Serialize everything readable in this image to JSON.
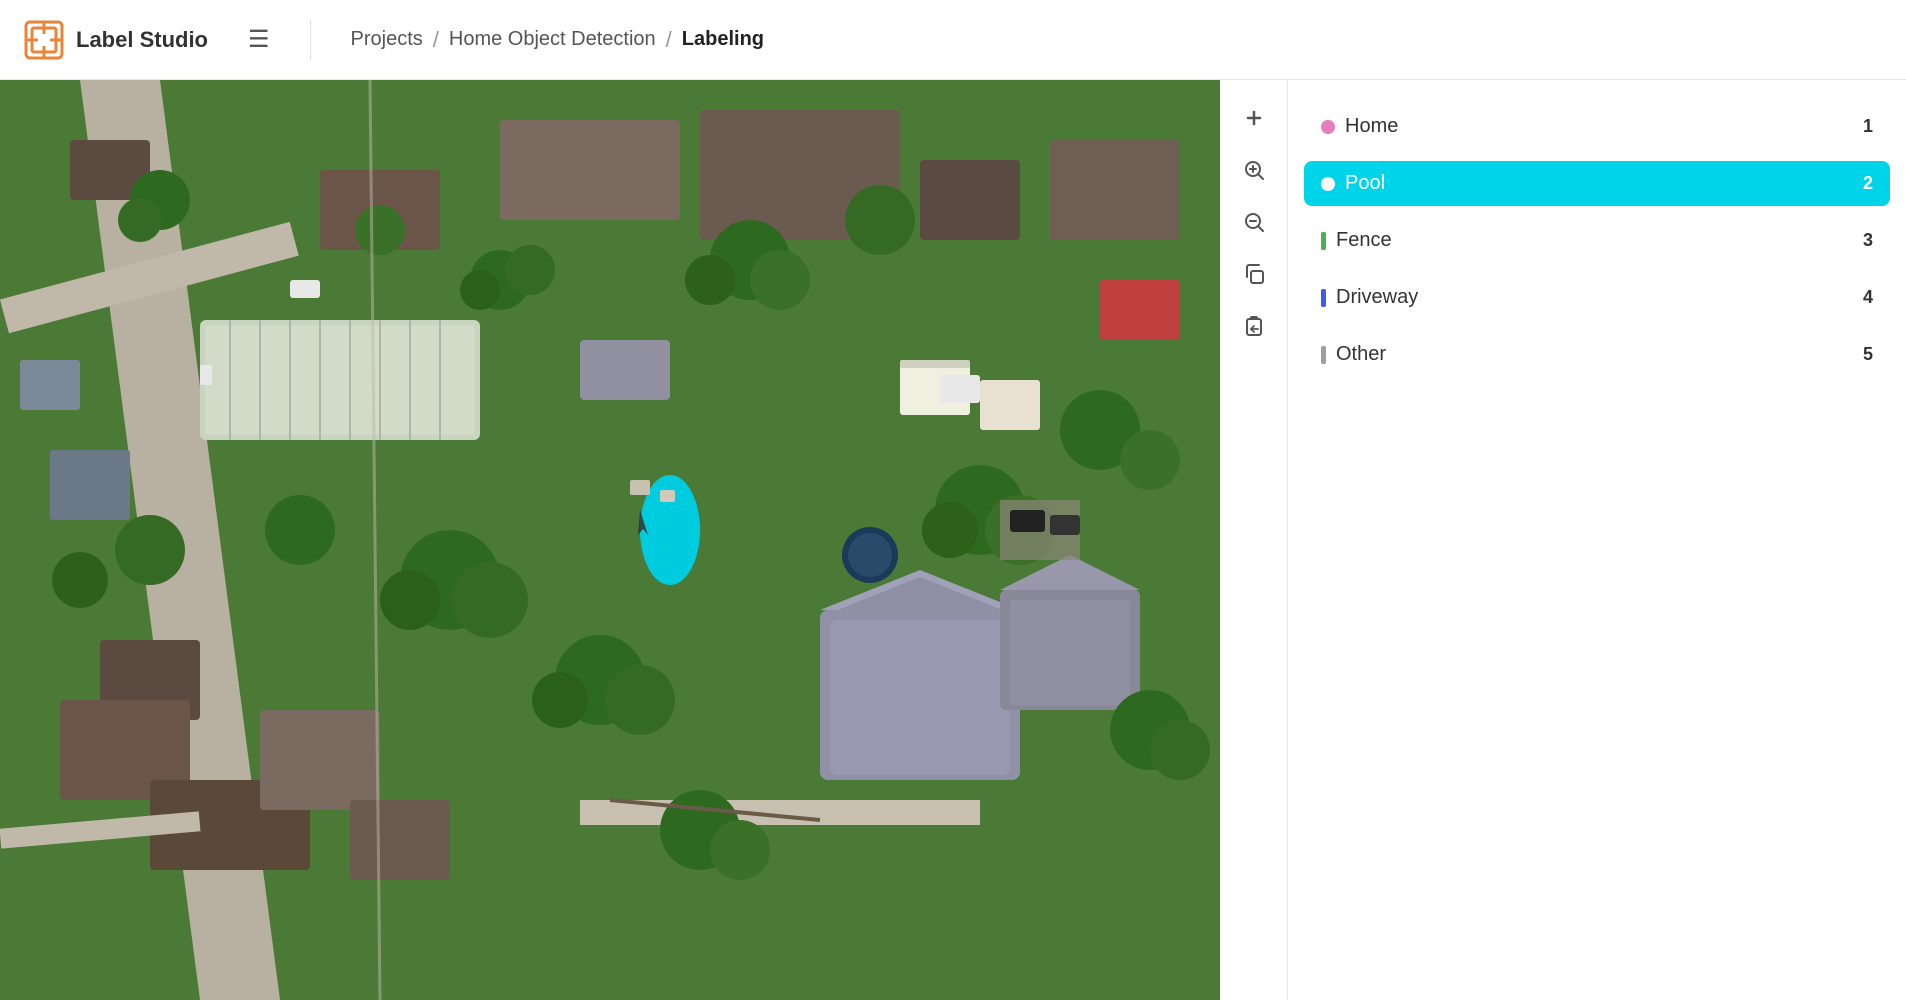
{
  "header": {
    "logo_text": "Label Studio",
    "menu_icon": "☰",
    "breadcrumb": {
      "projects_label": "Projects",
      "separator": "/",
      "project_name": "Home Object Detection",
      "separator2": "/",
      "current_page": "Labeling"
    }
  },
  "toolbar": {
    "tools": [
      {
        "id": "zoom-in",
        "icon": "+",
        "label": "Zoom In"
      },
      {
        "id": "zoom-in-circle",
        "icon": "⊕",
        "label": "Zoom In Circle"
      },
      {
        "id": "zoom-out",
        "icon": "⊖",
        "label": "Zoom Out"
      },
      {
        "id": "copy",
        "icon": "⧉",
        "label": "Copy"
      },
      {
        "id": "paste",
        "icon": "⮐",
        "label": "Paste"
      }
    ]
  },
  "labels": [
    {
      "id": "home",
      "name": "Home",
      "count": 1,
      "color": "#e87dbd",
      "active": false
    },
    {
      "id": "pool",
      "name": "Pool",
      "count": 2,
      "color": "#00d4e8",
      "active": true
    },
    {
      "id": "fence",
      "name": "Fence",
      "count": 3,
      "color": "#4caf50",
      "active": false
    },
    {
      "id": "driveway",
      "name": "Driveway",
      "count": 4,
      "color": "#3d5af1",
      "active": false
    },
    {
      "id": "other",
      "name": "Other",
      "count": 5,
      "color": "#9e9e9e",
      "active": false
    }
  ]
}
